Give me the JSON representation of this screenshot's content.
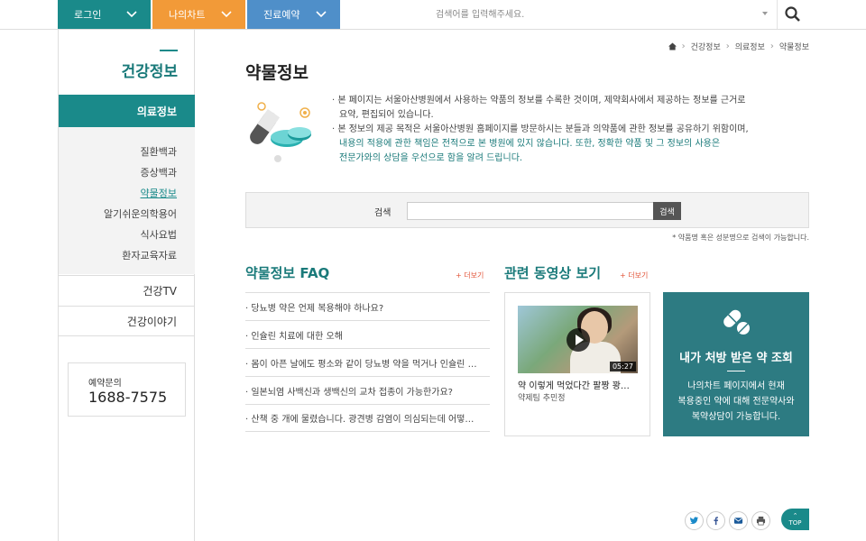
{
  "topbar": {
    "login_label": "로그인",
    "chart_label": "나의차트",
    "book_label": "진료예약",
    "search_placeholder": "검색어를 입력해주세요."
  },
  "sidebar": {
    "title": "건강정보",
    "active": "의료정보",
    "sub_items": [
      "질환백과",
      "증상백과",
      "약물정보",
      "알기쉬운의학용어",
      "식사요법",
      "환자교육자료"
    ],
    "items": [
      "건강TV",
      "건강이야기"
    ],
    "phone_label": "예약문의",
    "phone_number": "1688-7575"
  },
  "breadcrumb": [
    "건강정보",
    "의료정보",
    "약물정보"
  ],
  "page": {
    "title": "약물정보",
    "desc_lines": [
      "· 본 페이지는 서울아산병원에서 사용하는 약품의 정보를 수록한 것이며, 제약회사에서 제공하는 정보를 근거로",
      "  요약, 편집되어 있습니다.",
      "· 본 정보의 제공 목적은 서울아산병원 홈페이지를 방문하시는 분들과 의약품에 관한 정보를 공유하기 위함이며,",
      "  내용의 적용에 관한 책임은 전적으로 본 병원에 있지 않습니다. 또한, 정확한 약품 및 그 정보의 사용은",
      "  전문가와의 상담을 우선으로 함을 알려 드립니다."
    ]
  },
  "search": {
    "label": "검색",
    "button": "검색",
    "note": "* 약품명 혹은 성분명으로 검색이 가능합니다."
  },
  "faq": {
    "title": "약물정보 FAQ",
    "more": "+ 더보기",
    "items": [
      "· 당뇨병 약은 언제 복용해야 하나요?",
      "· 인슐린 치료에 대한 오해",
      "· 몸이 아픈 날에도 평소와 같이 당뇨병 약을 먹거나 인슐린 …",
      "· 일본뇌염 사백신과 생백신의 교차 접종이 가능한가요?",
      "· 산책 중 개에 물렸습니다. 광견병 감염이 의심되는데 어떻…"
    ]
  },
  "video": {
    "title": "관련 동영상 보기",
    "more": "+ 더보기",
    "duration": "05:27",
    "caption": "약 이렇게 먹었다간 팔짱 꽝…",
    "author": "약제팀 추민정"
  },
  "promo": {
    "title": "내가 처방 받은 약 조회",
    "desc": [
      "나의차트 페이지에서 현재",
      "복용중인 약에 대해 전문약사와",
      "복약상담이 가능합니다."
    ]
  },
  "top_button": "TOP",
  "colors": {
    "teal": "#1a8a8a",
    "orange": "#f29a38",
    "blue": "#4f8fc9",
    "promo": "#2d7b82",
    "accent_red": "#e2553a"
  }
}
